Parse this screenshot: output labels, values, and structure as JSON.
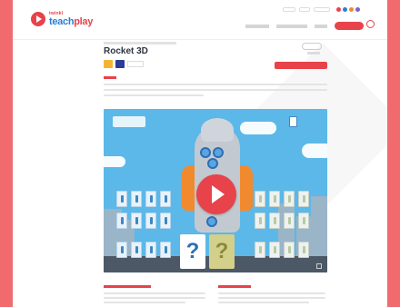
{
  "brand": {
    "small": "twinkl",
    "main_a": "teach",
    "main_b": "play",
    "accent": "#e8424a",
    "blue": "#2b7fd1"
  },
  "topbar": {
    "links": [
      "",
      "",
      ""
    ],
    "dot_colors": [
      "#e8424a",
      "#2b7fd1",
      "#f18a2e",
      "#7b61c9"
    ]
  },
  "nav": {
    "items": [
      "",
      "",
      ""
    ],
    "cta": ""
  },
  "page": {
    "breadcrumb": "",
    "title": "Rocket 3D",
    "badge_colors": [
      "#f5b335",
      "#2d3c96"
    ],
    "badge_label": "",
    "side_label": "",
    "play_label": "",
    "section_label": "",
    "description": ""
  },
  "game": {
    "logo_text": "",
    "question_mark": "?"
  },
  "footer": {
    "left_heading": "",
    "right_heading": ""
  }
}
